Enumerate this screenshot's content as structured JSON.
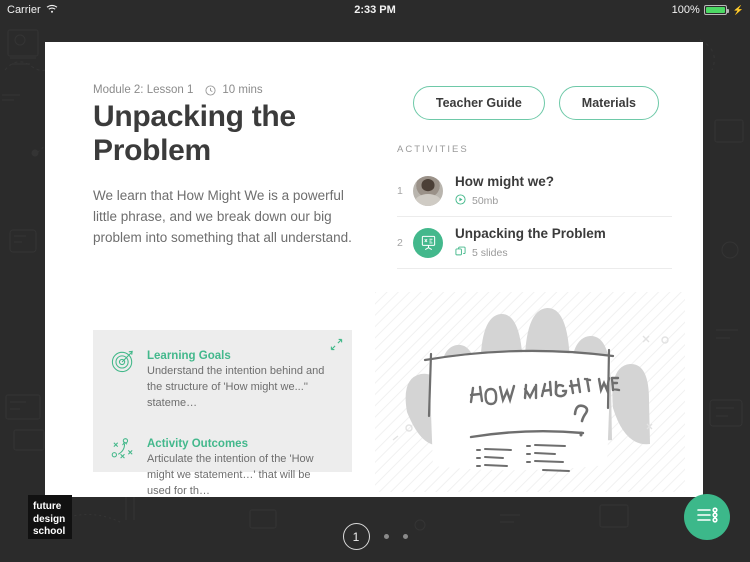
{
  "statusbar": {
    "carrier": "Carrier",
    "wifi_icon": "wifi-icon",
    "time": "2:33 PM",
    "battery_percent": "100%",
    "battery_icon": "battery-full-icon",
    "charging_icon": "charging-bolt-icon"
  },
  "lesson": {
    "module": "Module 2: Lesson 1",
    "clock_icon": "clock-icon",
    "duration": "10 mins",
    "title": "Unpacking the Problem",
    "description": "We learn that How Might We is a powerful little phrase, and we break down our big problem into something that all understand."
  },
  "header_buttons": {
    "teacher_guide": "Teacher Guide",
    "materials": "Materials"
  },
  "activities": {
    "heading": "ACTIVITIES",
    "items": [
      {
        "number": "1",
        "icon": "user-avatar-photo",
        "title": "How might we?",
        "meta_icon": "play-circle-icon",
        "meta": "50mb"
      },
      {
        "number": "2",
        "icon": "presentation-board-icon",
        "title": "Unpacking the Problem",
        "meta_icon": "slides-copy-icon",
        "meta": "5 slides"
      }
    ]
  },
  "info_panel": {
    "expand_icon": "expand-arrows-icon",
    "blocks": [
      {
        "icon": "target-dartboard-icon",
        "title": "Learning Goals",
        "body": "Understand the intention behind and the structure of 'How might we...'' stateme…"
      },
      {
        "icon": "strategy-play-icon",
        "title": "Activity Outcomes",
        "body": "Articulate the intention of the 'How might we statement…' that will be used for th…"
      }
    ]
  },
  "illustration": {
    "name": "how-might-we-whiteboard-sketch",
    "text": "HOW MIGHT WE",
    "question_mark": "?"
  },
  "logo": {
    "line1": "future",
    "line2": "design",
    "line3": "school"
  },
  "pagination": {
    "current": "1",
    "dots": [
      "",
      ""
    ]
  },
  "fab": {
    "icon": "list-menu-icon"
  },
  "colors": {
    "accent_green": "#43b88a",
    "pill_border": "#6ec9a8",
    "background_dark": "#2b2b2b",
    "panel_gray": "#ededed",
    "battery_green": "#4cd964"
  }
}
